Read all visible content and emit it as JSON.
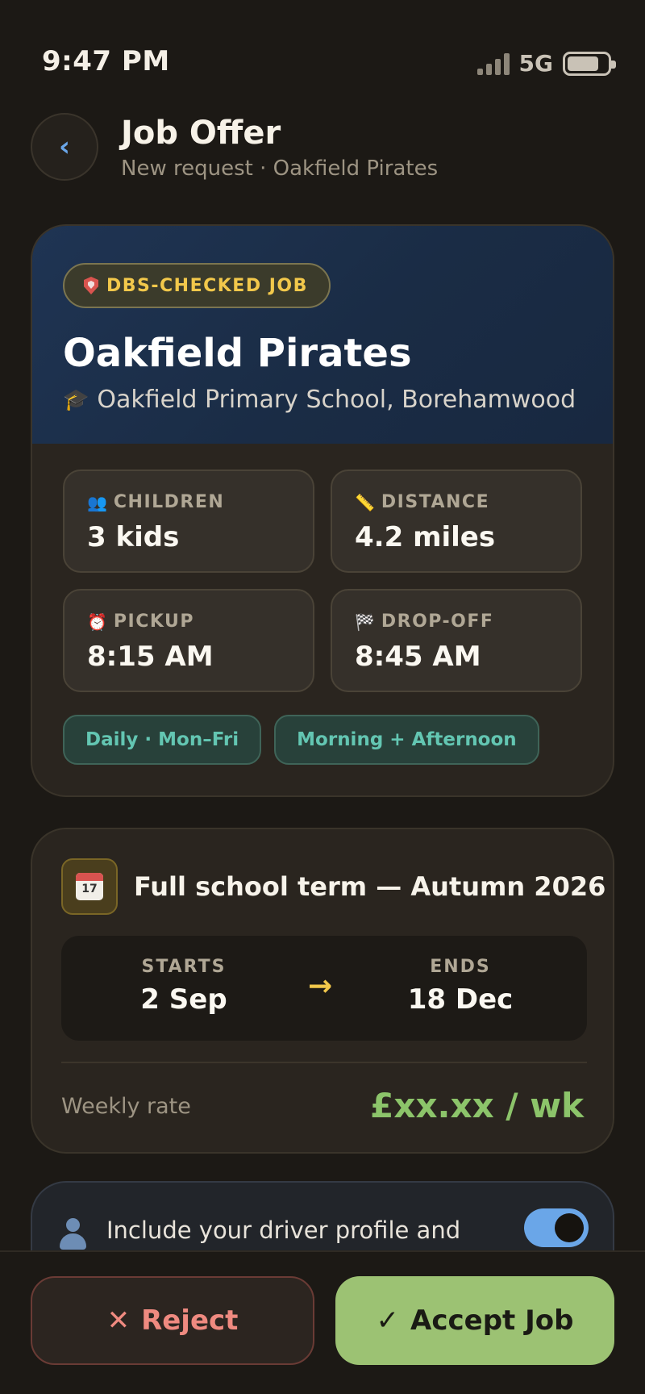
{
  "status_bar": {
    "time": "9:47 PM",
    "network": "5G"
  },
  "header": {
    "back_icon": "‹",
    "title": "Job Offer",
    "subtitle": "New request · Oakfield Pirates"
  },
  "job": {
    "badge": "DBS-CHECKED JOB",
    "title": "Oakfield Pirates",
    "school": "Oakfield Primary School, Borehamwood",
    "stats": [
      {
        "icon": "👥",
        "label": "CHILDREN",
        "value": "3 kids"
      },
      {
        "icon": "📏",
        "label": "DISTANCE",
        "value": "4.2 miles"
      },
      {
        "icon": "⏰",
        "label": "PICKUP",
        "value": "8:15 AM"
      },
      {
        "icon": "🏁",
        "label": "DROP-OFF",
        "value": "8:45 AM"
      }
    ],
    "tags": [
      "Daily · Mon–Fri",
      "Morning + Afternoon"
    ]
  },
  "term": {
    "calendar_day": "17",
    "title": "Full school term — Autumn 2026",
    "starts_label": "STARTS",
    "starts_value": "2 Sep",
    "ends_label": "ENDS",
    "ends_value": "18 Dec",
    "rate_label": "Weekly rate",
    "rate_value": "£xx.xx / wk"
  },
  "profile": {
    "text": "Include your driver profile and trusted-household history in",
    "toggle_on": true
  },
  "actions": {
    "reject_label": "Reject",
    "accept_label": "Accept Job"
  },
  "colors": {
    "accent_blue": "#6aa6e8",
    "accept_green": "#9cc273",
    "reject_red": "#ef8a80",
    "badge_gold": "#f2c84b",
    "rate_green": "#8cc46a"
  }
}
